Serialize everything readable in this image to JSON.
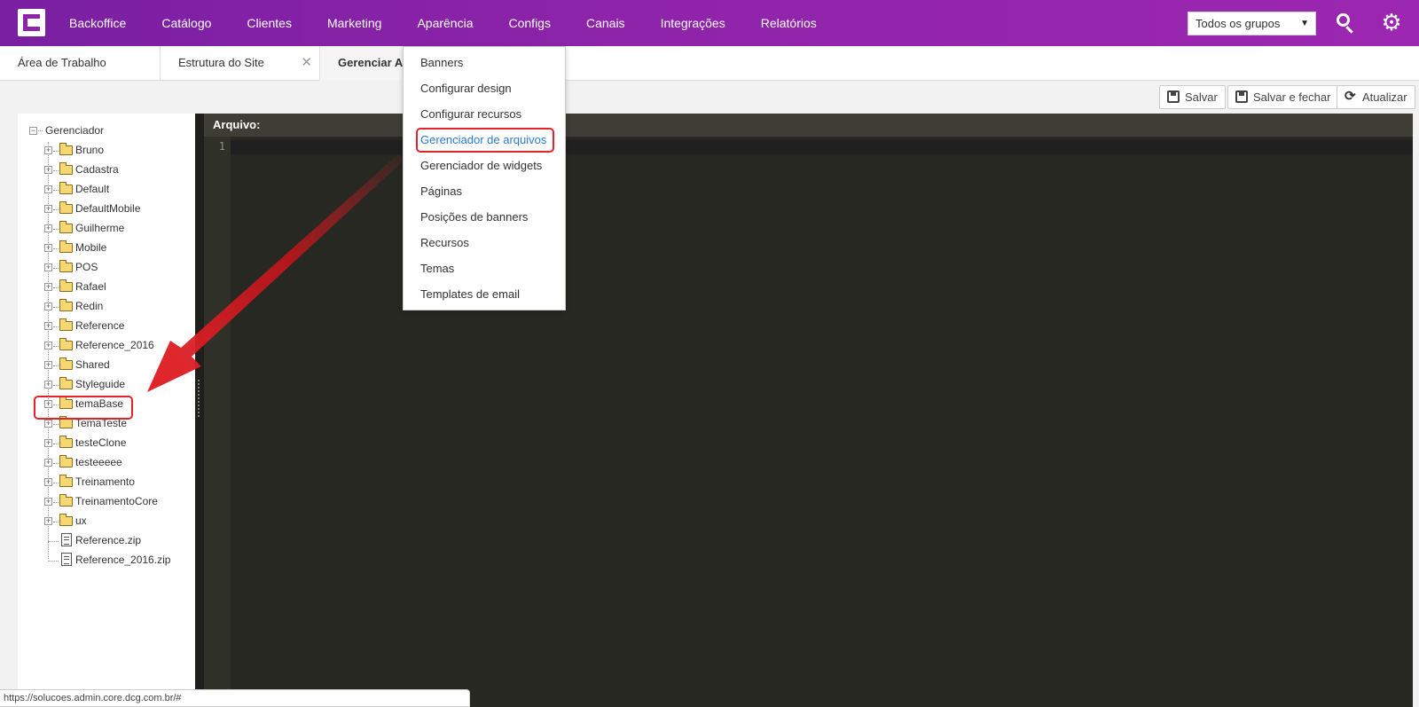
{
  "topbar": {
    "brand_color": "#8e24aa",
    "nav": [
      {
        "label": "Backoffice"
      },
      {
        "label": "Catálogo"
      },
      {
        "label": "Clientes"
      },
      {
        "label": "Marketing"
      },
      {
        "label": "Aparência"
      },
      {
        "label": "Configs"
      },
      {
        "label": "Canais"
      },
      {
        "label": "Integrações"
      },
      {
        "label": "Relatórios"
      }
    ],
    "group_select": {
      "value": "Todos os grupos"
    },
    "search_icon": "search-icon",
    "settings_icon": "gear-icon"
  },
  "tabs": [
    {
      "label": "Área de Trabalho"
    },
    {
      "label": "Estrutura do Site",
      "closable": true
    },
    {
      "label": "Gerenciar Arc"
    }
  ],
  "toolbar": {
    "save_label": "Salvar",
    "save_close_label": "Salvar e fechar",
    "refresh_label": "Atualizar"
  },
  "tree": {
    "root": "Gerenciador",
    "folders": [
      "Bruno",
      "Cadastra",
      "Default",
      "DefaultMobile",
      "Guilherme",
      "Mobile",
      "POS",
      "Rafael",
      "Redin",
      "Reference",
      "Reference_2016",
      "Shared",
      "Styleguide",
      "temaBase",
      "TemaTeste",
      "testeClone",
      "testeeeee",
      "Treinamento",
      "TreinamentoCore",
      "ux"
    ],
    "files": [
      "Reference.zip",
      "Reference_2016.zip"
    ],
    "highlighted": "temaBase"
  },
  "editor": {
    "header": "Arquivo:",
    "line_number": "1"
  },
  "dropdown": {
    "items": [
      "Banners",
      "Configurar design",
      "Configurar recursos",
      "Gerenciador de arquivos",
      "Gerenciador de widgets",
      "Páginas",
      "Posições de banners",
      "Recursos",
      "Temas",
      "Templates de email"
    ],
    "highlighted": "Gerenciador de arquivos",
    "highlight_color": "#2a7bd4"
  },
  "status_url": "https://solucoes.admin.core.dcg.com.br/#",
  "annotation_color": "#e2232a"
}
